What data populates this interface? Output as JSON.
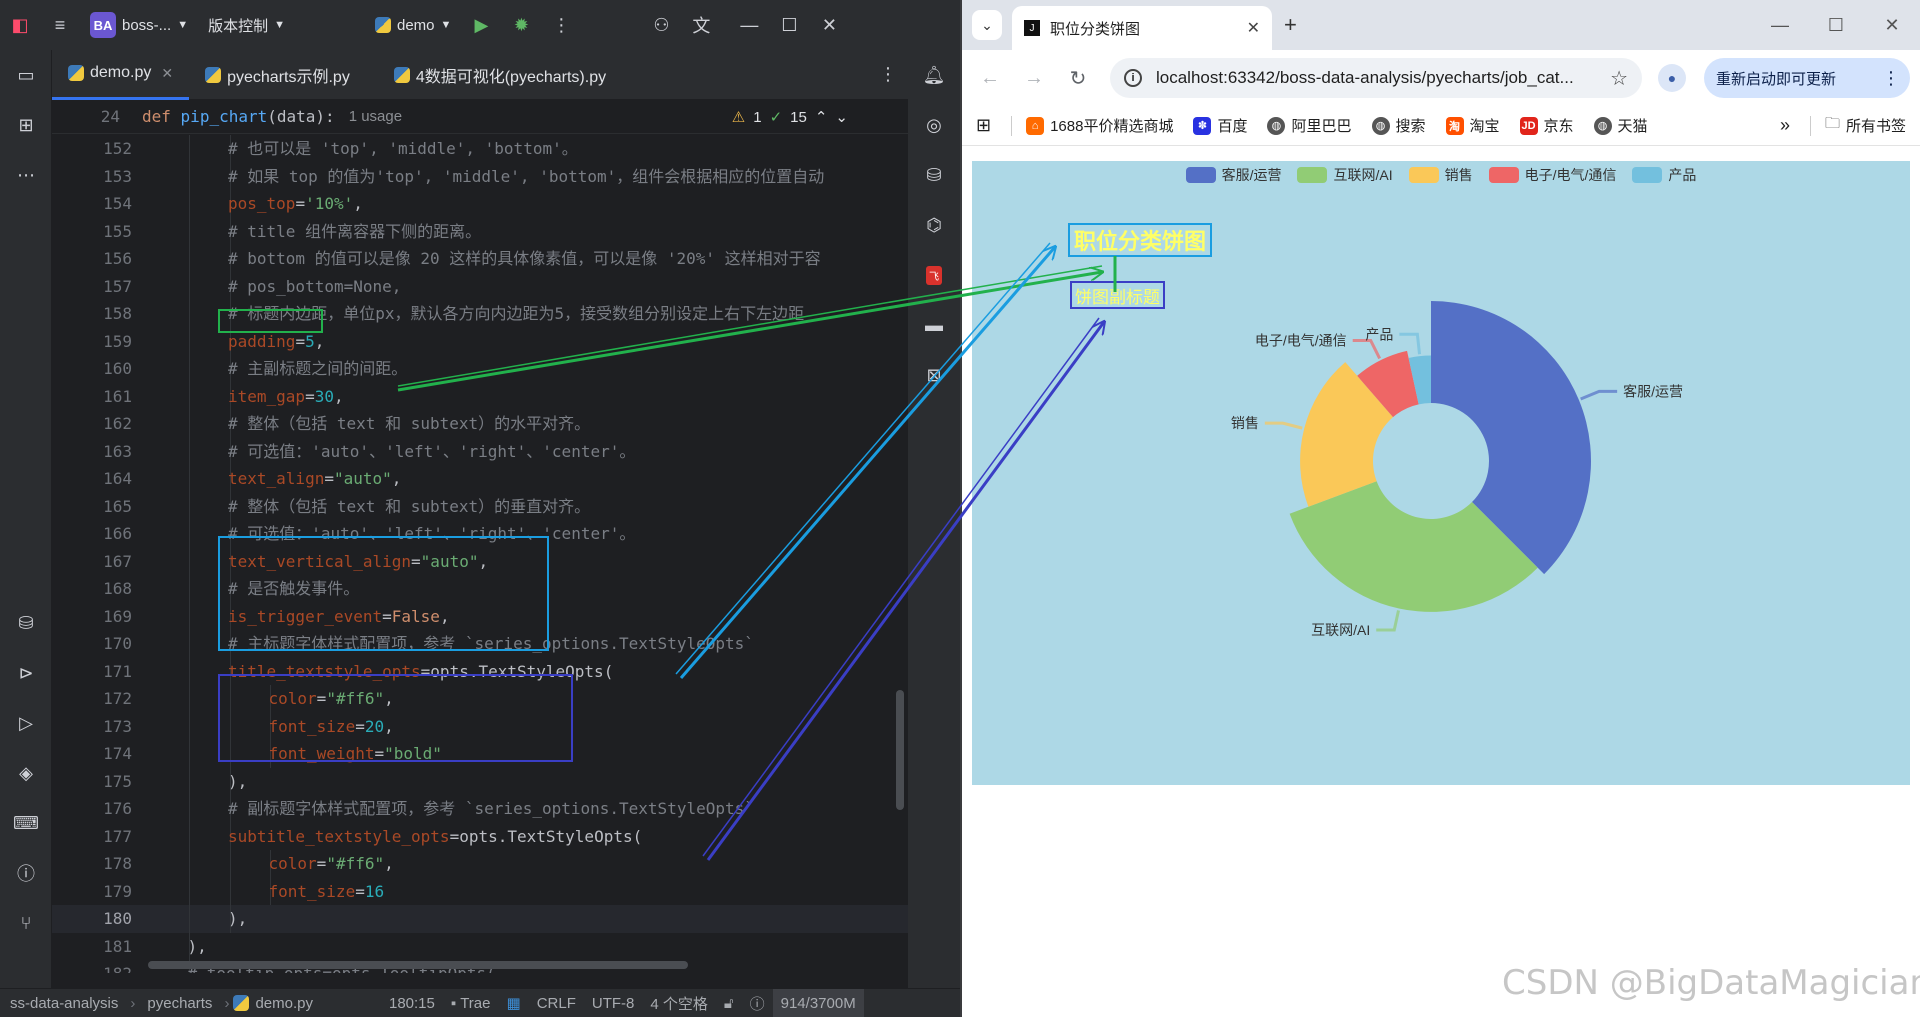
{
  "ide": {
    "project_badge": "BA",
    "project_name": "boss-...",
    "vcs_label": "版本控制",
    "run_config": "demo",
    "tabs": [
      {
        "label": "demo.py",
        "active": true
      },
      {
        "label": "pyecharts示例.py"
      },
      {
        "label": "4数据可视化(pyecharts).py"
      }
    ],
    "breadcrumb": {
      "line": "24",
      "kw": "def",
      "fn": "pip_chart",
      "args": "(data):",
      "usage": "1 usage"
    },
    "inspection": {
      "warnings": "1",
      "checks": "15"
    },
    "statusbar": {
      "project": "ss-data-analysis",
      "folder": "pyecharts",
      "file": "demo.py",
      "position": "180:15",
      "plugin": "Trae",
      "line_sep": "CRLF",
      "encoding": "UTF-8",
      "indent": "4 个空格",
      "memory": "914/3700M"
    }
  },
  "code_lines": [
    {
      "n": "152",
      "indent": 3,
      "parts": [
        [
          "cm",
          "# 也可以是 'top', 'middle', 'bottom'。"
        ]
      ]
    },
    {
      "n": "153",
      "indent": 3,
      "parts": [
        [
          "cm",
          "# 如果 top 的值为'top', 'middle', 'bottom'，组件会根据相应的位置自动"
        ]
      ]
    },
    {
      "n": "154",
      "indent": 3,
      "parts": [
        [
          "prm",
          "pos_top"
        ],
        [
          "op",
          "="
        ],
        [
          "str",
          "'10%'"
        ],
        [
          "op",
          ","
        ]
      ]
    },
    {
      "n": "155",
      "indent": 3,
      "parts": [
        [
          "cm",
          "# title 组件离容器下侧的距离。"
        ]
      ]
    },
    {
      "n": "156",
      "indent": 3,
      "parts": [
        [
          "cm",
          "# bottom 的值可以是像 20 这样的具体像素值，可以是像 '20%' 这样相对于容"
        ]
      ]
    },
    {
      "n": "157",
      "indent": 3,
      "parts": [
        [
          "cm",
          "# pos_bottom=None,"
        ]
      ]
    },
    {
      "n": "158",
      "indent": 3,
      "parts": [
        [
          "cm",
          "# 标题内边距，单位px，默认各方向内边距为5，接受数组分别设定上右下左边距"
        ]
      ]
    },
    {
      "n": "159",
      "indent": 3,
      "parts": [
        [
          "prm",
          "padding"
        ],
        [
          "op",
          "="
        ],
        [
          "num",
          "5"
        ],
        [
          "op",
          ","
        ]
      ]
    },
    {
      "n": "160",
      "indent": 3,
      "parts": [
        [
          "cm",
          "# 主副标题之间的间距。"
        ]
      ]
    },
    {
      "n": "161",
      "indent": 3,
      "parts": [
        [
          "prm",
          "item_gap"
        ],
        [
          "op",
          "="
        ],
        [
          "num",
          "30"
        ],
        [
          "op",
          ","
        ]
      ]
    },
    {
      "n": "162",
      "indent": 3,
      "parts": [
        [
          "cm",
          "# 整体（包括 text 和 subtext）的水平对齐。"
        ]
      ]
    },
    {
      "n": "163",
      "indent": 3,
      "parts": [
        [
          "cm",
          "# 可选值：'auto'、'left'、'right'、'center'。"
        ]
      ]
    },
    {
      "n": "164",
      "indent": 3,
      "parts": [
        [
          "prm",
          "text_align"
        ],
        [
          "op",
          "="
        ],
        [
          "str",
          "\"auto\""
        ],
        [
          "op",
          ","
        ]
      ]
    },
    {
      "n": "165",
      "indent": 3,
      "parts": [
        [
          "cm",
          "# 整体（包括 text 和 subtext）的垂直对齐。"
        ]
      ]
    },
    {
      "n": "166",
      "indent": 3,
      "parts": [
        [
          "cm",
          "# 可选值：'auto'、'left'、'right'、'center'。"
        ]
      ]
    },
    {
      "n": "167",
      "indent": 3,
      "parts": [
        [
          "prm",
          "text_vertical_align"
        ],
        [
          "op",
          "="
        ],
        [
          "str",
          "\"auto\""
        ],
        [
          "op",
          ","
        ]
      ]
    },
    {
      "n": "168",
      "indent": 3,
      "parts": [
        [
          "cm",
          "# 是否触发事件。"
        ]
      ]
    },
    {
      "n": "169",
      "indent": 3,
      "parts": [
        [
          "prm",
          "is_trigger_event"
        ],
        [
          "op",
          "="
        ],
        [
          "kw",
          "False"
        ],
        [
          "op",
          ","
        ]
      ]
    },
    {
      "n": "170",
      "indent": 3,
      "parts": [
        [
          "cm",
          "# 主标题字体样式配置项，参考 `series_options.TextStyleOpts`"
        ]
      ]
    },
    {
      "n": "171",
      "indent": 3,
      "parts": [
        [
          "prm",
          "title_textstyle_opts"
        ],
        [
          "op",
          "="
        ],
        [
          "id",
          "opts.TextStyleOpts("
        ]
      ]
    },
    {
      "n": "172",
      "indent": 4,
      "parts": [
        [
          "prm",
          "color"
        ],
        [
          "op",
          "="
        ],
        [
          "str",
          "\"#ff6\""
        ],
        [
          "op",
          ","
        ]
      ]
    },
    {
      "n": "173",
      "indent": 4,
      "parts": [
        [
          "prm",
          "font_size"
        ],
        [
          "op",
          "="
        ],
        [
          "num",
          "20"
        ],
        [
          "op",
          ","
        ]
      ]
    },
    {
      "n": "174",
      "indent": 4,
      "parts": [
        [
          "prm",
          "font_weight"
        ],
        [
          "op",
          "="
        ],
        [
          "str",
          "\"bold\""
        ]
      ]
    },
    {
      "n": "175",
      "indent": 3,
      "parts": [
        [
          "op",
          "),"
        ]
      ]
    },
    {
      "n": "176",
      "indent": 3,
      "parts": [
        [
          "cm",
          "# 副标题字体样式配置项，参考 `series_options.TextStyleOpts`"
        ]
      ]
    },
    {
      "n": "177",
      "indent": 3,
      "parts": [
        [
          "prm",
          "subtitle_textstyle_opts"
        ],
        [
          "op",
          "="
        ],
        [
          "id",
          "opts.TextStyleOpts("
        ]
      ]
    },
    {
      "n": "178",
      "indent": 4,
      "parts": [
        [
          "prm",
          "color"
        ],
        [
          "op",
          "="
        ],
        [
          "str",
          "\"#ff6\""
        ],
        [
          "op",
          ","
        ]
      ]
    },
    {
      "n": "179",
      "indent": 4,
      "parts": [
        [
          "prm",
          "font_size"
        ],
        [
          "op",
          "="
        ],
        [
          "num",
          "16"
        ]
      ]
    },
    {
      "n": "180",
      "indent": 3,
      "parts": [
        [
          "op",
          "),"
        ]
      ],
      "current": true
    },
    {
      "n": "181",
      "indent": 2,
      "parts": [
        [
          "op",
          "),"
        ]
      ]
    },
    {
      "n": "182",
      "indent": 2,
      "parts": [
        [
          "cm",
          "# tooltip_opts=opts.TooltipOpts("
        ]
      ]
    }
  ],
  "browser": {
    "tab_title": "职位分类饼图",
    "url": "localhost:63342/boss-data-analysis/pyecharts/job_cat...",
    "update_label": "重新启动即可更新",
    "bookmarks": [
      "1688平价精选商城",
      "百度",
      "阿里巴巴",
      "搜索",
      "淘宝",
      "京东",
      "天猫"
    ],
    "all_bookmarks": "所有书签",
    "bookmark_colors": [
      "#ff6a00",
      "#2932e1",
      "#555555",
      "#555555",
      "#ff5000",
      "#e1251b",
      "#555555"
    ]
  },
  "chart_data": {
    "type": "pie",
    "style": "ring",
    "title": "职位分类饼图",
    "subtitle": "饼图副标题",
    "background": "#add8e6",
    "legend": [
      "客服/运营",
      "互联网/AI",
      "销售",
      "电子/电气/通信",
      "产品"
    ],
    "legend_position": "top",
    "colors": [
      "#5470c6",
      "#91cc75",
      "#fac858",
      "#ee6666",
      "#73c0de"
    ],
    "series": [
      {
        "name": "客服/运营",
        "value": 33
      },
      {
        "name": "互联网/AI",
        "value": 28
      },
      {
        "name": "销售",
        "value": 17
      },
      {
        "name": "电子/电气/通信",
        "value": 7
      },
      {
        "name": "产品",
        "value": 3
      }
    ]
  },
  "watermark": "CSDN @BigDataMagician",
  "annotation_colors": {
    "green": "#22b14c",
    "cyan": "#1a9de0",
    "blue": "#3a3ec5"
  }
}
